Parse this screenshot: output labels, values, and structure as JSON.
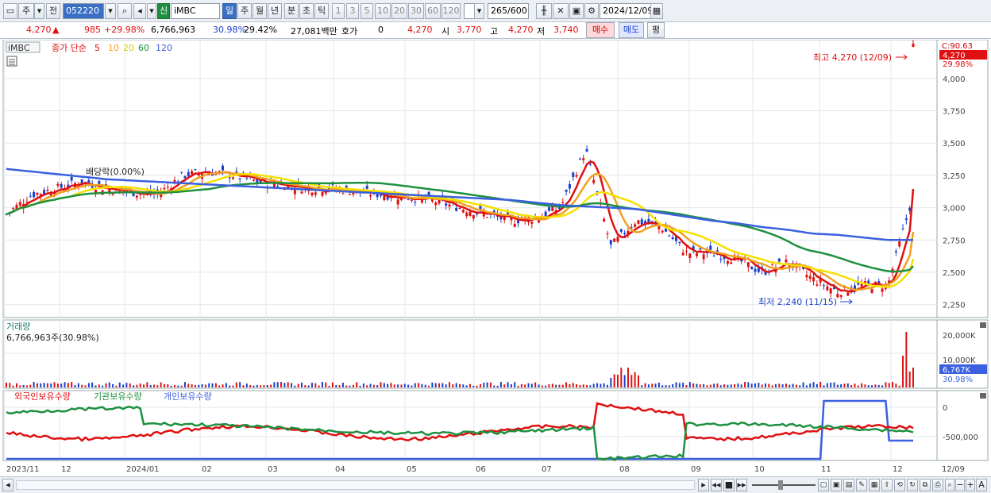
{
  "toolbar": {
    "market_tab": "주",
    "prev_tab": "전",
    "code": "052220",
    "badge": "신",
    "name": "iMBC",
    "periods": [
      "일",
      "주",
      "월",
      "년",
      "분",
      "초",
      "틱"
    ],
    "selected_period": "일",
    "intervals": [
      "1",
      "3",
      "5",
      "10",
      "20",
      "30",
      "60",
      "120"
    ],
    "count_current": "265",
    "count_total": "/600",
    "date": "2024/12/09"
  },
  "quote": {
    "price": "4,270",
    "change": "985",
    "change_pct": "+29.98%",
    "volume": "6,766,963",
    "vol_ratio": "30.98%",
    "turnover": "29.42%",
    "amount": "27,081백만",
    "hoga_label": "호가",
    "hoga_value": "0",
    "hoga_price": "4,270",
    "open_label": "시",
    "open": "3,770",
    "high_label": "고",
    "high": "4,270",
    "low_label": "저",
    "low": "3,740",
    "buy_label": "매수",
    "sell_label": "매도",
    "eval_label": "평"
  },
  "price_chart": {
    "symbol": "iMBC",
    "legend_title": "종가 단순",
    "ma_labels": [
      "5",
      "10",
      "20",
      "60",
      "120"
    ],
    "ma_colors": [
      "#e01010",
      "#f0a020",
      "#f5e000",
      "#1e9040",
      "#3a5fe0"
    ],
    "y_ticks": [
      "4,000",
      "3,750",
      "3,500",
      "3,250",
      "3,000",
      "2,750",
      "2,500",
      "2,250"
    ],
    "top_label": "C:90.63",
    "cur_price_tag": "4,270",
    "cur_pct": "29.98%",
    "high_annotation": "최고 4,270 (12/09)",
    "low_annotation": "최저 2,240 (11/15)",
    "dividend_annotation": "배당락(0.00%)"
  },
  "volume_chart": {
    "title": "거래량",
    "value": "6,766,963주(30.98%)",
    "y_ticks": [
      "20,000K",
      "10,000K"
    ],
    "cur_tag": "6,767K",
    "cur_pct": "30.98%"
  },
  "holding_chart": {
    "legend": [
      "외국인보유수량",
      "기관보유수량",
      "개인보유수량"
    ],
    "colors": [
      "#e01010",
      "#1e9040",
      "#3a5fe0"
    ],
    "y_ticks": [
      "0",
      "-500,000"
    ]
  },
  "x_axis": {
    "labels": [
      "2023/11",
      "12",
      "2024/01",
      "02",
      "03",
      "04",
      "05",
      "06",
      "07",
      "08",
      "09",
      "10",
      "11",
      "12"
    ],
    "right_label": "12/09"
  },
  "chart_data": {
    "type": "line",
    "title": "",
    "ylim": [
      2150,
      4300
    ],
    "series": [
      {
        "name": "5",
        "values": [
          2950,
          3100,
          3150,
          3200,
          3150,
          3120,
          3100,
          3250,
          3280,
          3250,
          3200,
          3180,
          3150,
          3150,
          3120,
          3100,
          3080,
          3050,
          3000,
          2950,
          2900,
          2920,
          3000,
          3450,
          2700,
          2900,
          2850,
          2650,
          2650,
          2600,
          2500,
          2580,
          2450,
          2350,
          2400,
          2400,
          3100
        ]
      },
      {
        "name": "120",
        "values": [
          3300,
          3280,
          3260,
          3240,
          3220,
          3210,
          3200,
          3190,
          3180,
          3170,
          3160,
          3150,
          3140,
          3130,
          3120,
          3110,
          3100,
          3090,
          3080,
          3070,
          3060,
          3040,
          3020,
          3010,
          3000,
          2990,
          2960,
          2930,
          2900,
          2880,
          2850,
          2830,
          2800,
          2790,
          2770,
          2750,
          2750
        ]
      }
    ],
    "high": {
      "value": 4270,
      "date": "12/09"
    },
    "low": {
      "value": 2240,
      "date": "11/15"
    }
  }
}
